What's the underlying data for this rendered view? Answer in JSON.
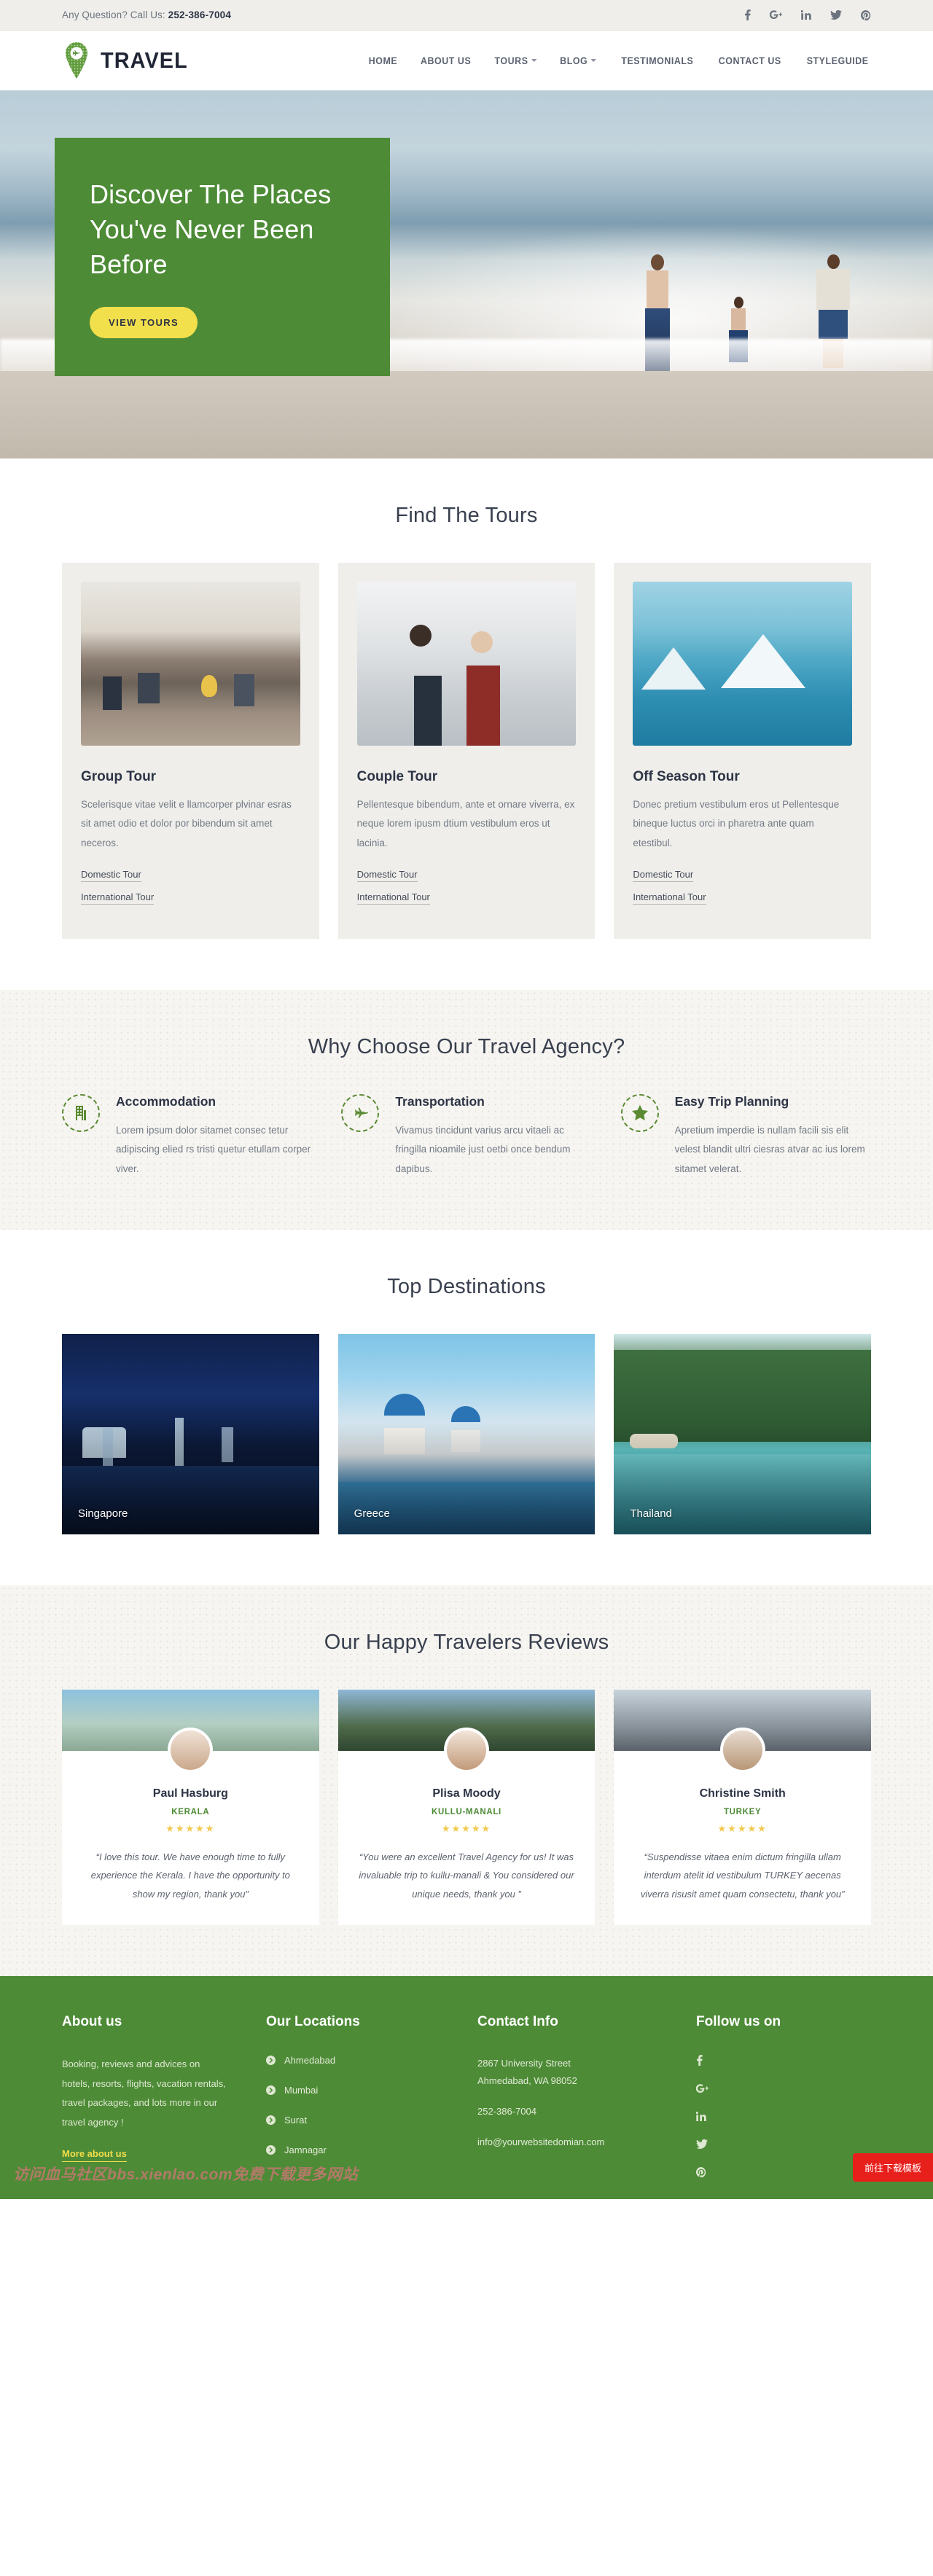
{
  "topbar": {
    "phone_label": "Any Question? Call Us:",
    "phone": "252-386-7004",
    "social": [
      {
        "name": "facebook",
        "label": "f"
      },
      {
        "name": "google-plus",
        "label": "G+"
      },
      {
        "name": "linkedin",
        "label": "in"
      },
      {
        "name": "twitter",
        "label": "t"
      },
      {
        "name": "pinterest",
        "label": "P"
      }
    ]
  },
  "header": {
    "brand": "TRAVEL",
    "nav": [
      {
        "label": "HOME",
        "caret": false
      },
      {
        "label": "ABOUT US",
        "caret": false
      },
      {
        "label": "TOURS",
        "caret": true
      },
      {
        "label": "BLOG",
        "caret": true
      },
      {
        "label": "TESTIMONIALS",
        "caret": false
      },
      {
        "label": "CONTACT US",
        "caret": false
      },
      {
        "label": "STYLEGUIDE",
        "caret": false
      }
    ]
  },
  "hero": {
    "title": "Discover The Places You've Never Been Before",
    "button": "VIEW TOURS",
    "box_color": "#4d8b36",
    "button_color": "#f2df4c"
  },
  "tours": {
    "title": "Find The Tours",
    "cards": [
      {
        "name": "Group Tour",
        "desc": "Scelerisque vitae velit e llamcorper plvinar esras sit amet odio et dolor por bibendum sit amet neceros.",
        "link1": "Domestic Tour",
        "link2": "International Tour",
        "image": "campfire-group-photo"
      },
      {
        "name": "Couple Tour",
        "desc": "Pellentesque bibendum, ante et ornare viverra, ex neque lorem ipusm dtium vestibulum eros ut lacinia.",
        "link1": "Domestic Tour",
        "link2": "International Tour",
        "image": "couple-in-snow-photo"
      },
      {
        "name": "Off Season Tour",
        "desc": "Donec pretium vestibulum eros ut Pellentesque bineque luctus orci in pharetra ante quam etestibul.",
        "link1": "Domestic Tour",
        "link2": "International Tour",
        "image": "snowy-mountains-photo"
      }
    ]
  },
  "why": {
    "title": "Why Choose Our Travel Agency?",
    "features": [
      {
        "icon": "building-icon",
        "title": "Accommodation",
        "desc": "Lorem ipsum dolor sitamet consec tetur adipiscing elied rs tristi quetur etullam corper viver."
      },
      {
        "icon": "plane-icon",
        "title": "Transportation",
        "desc": "Vivamus tincidunt varius arcu vitaeli ac fringilla nioamile just oetbi once bendum dapibus."
      },
      {
        "icon": "star-icon",
        "title": "Easy Trip Planning",
        "desc": "Apretium imperdie is nullam facili sis elit velest blandit ultri ciesras atvar ac ius lorem sitamet velerat."
      }
    ]
  },
  "destinations": {
    "title": "Top Destinations",
    "items": [
      {
        "label": "Singapore",
        "image": "singapore-skyline-night"
      },
      {
        "label": "Greece",
        "image": "greece-santorini-blue-dome"
      },
      {
        "label": "Thailand",
        "image": "thailand-beach-turquoise"
      }
    ]
  },
  "reviews": {
    "title": "Our Happy Travelers Reviews",
    "items": [
      {
        "name": "Paul Hasburg",
        "place": "KERALA",
        "stars": "★★★★★",
        "text": "“I love this tour. We have enough time to fully experience the Kerala. I have the opportunity to show my region, thank you”",
        "cover": "kerala-houseboat",
        "avatar": "paul-hasburg-avatar"
      },
      {
        "name": "Plisa Moody",
        "place": "KULLU-MANALI",
        "stars": "★★★★★",
        "text": "“You were an excellent Travel Agency for us! It was invaluable trip to kullu-manali & You considered our unique needs, thank you ”",
        "cover": "kullu-manali-forest",
        "avatar": "plisa-moody-avatar"
      },
      {
        "name": "Christine Smith",
        "place": "TURKEY",
        "stars": "★★★★★",
        "text": "“Suspendisse vitaea enim dictum fringilla ullam interdum atelit id vestibulum TURKEY aecenas viverra risusit amet quam consectetu, thank you”",
        "cover": "turkey-hot-air-balloons",
        "avatar": "christine-smith-avatar"
      }
    ]
  },
  "footer": {
    "about_title": "About us",
    "about_text": "Booking, reviews and advices on hotels, resorts, flights, vacation rentals, travel packages, and lots more in our travel agency !",
    "about_more": "More about us",
    "locations_title": "Our Locations",
    "locations": [
      "Ahmedabad",
      "Mumbai",
      "Surat",
      "Jamnagar"
    ],
    "contact_title": "Contact Info",
    "address_line1": "2867 University Street",
    "address_line2": "Ahmedabad, WA 98052",
    "phone": "252-386-7004",
    "email": "info@yourwebsitedomian.com",
    "follow_title": "Follow us on",
    "social": [
      {
        "name": "facebook",
        "label": "f"
      },
      {
        "name": "google-plus",
        "label": "G+"
      },
      {
        "name": "linkedin",
        "label": "in"
      },
      {
        "name": "twitter",
        "label": "t"
      },
      {
        "name": "pinterest",
        "label": "P"
      }
    ],
    "bg_color": "#4d8b36"
  },
  "overlay": {
    "watermark": "访问血马社区bbs.xienlao.com免费下载更多网站",
    "download_button": "前往下载模板"
  }
}
